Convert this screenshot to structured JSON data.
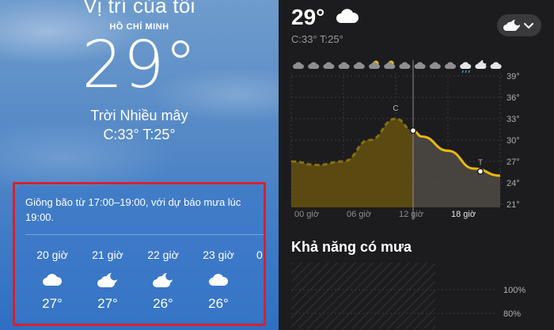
{
  "location": {
    "title": "Vị trí của tôi",
    "city": "HỒ CHÍ MINH",
    "temperature": "29°",
    "condition": "Trời Nhiều mây",
    "high_low": "C:33°  T:25°"
  },
  "forecast_card": {
    "text": "Giông bão từ 17:00–19:00, với dự báo mưa lúc 19:00.",
    "hours": [
      {
        "label": "20 giờ",
        "icon": "cloud-icon",
        "temp": "27°"
      },
      {
        "label": "21 giờ",
        "icon": "moon-cloud-icon",
        "temp": "27°"
      },
      {
        "label": "22 giờ",
        "icon": "moon-cloud-icon",
        "temp": "26°"
      },
      {
        "label": "23 giờ",
        "icon": "cloud-icon",
        "temp": "26°"
      }
    ],
    "next_hour_partial": "0"
  },
  "detail": {
    "temperature": "29°",
    "high_low": "C:33° T:25°",
    "rain_section_title": "Khả năng có mưa"
  },
  "chart_data": {
    "type": "area",
    "x": [
      "00 giờ",
      "03 giờ",
      "06 giờ",
      "09 giờ",
      "12 giờ",
      "15 giờ",
      "18 giờ",
      "21 giờ",
      "24 giờ"
    ],
    "xticks": [
      "00 giờ",
      "06 giờ",
      "12 giờ",
      "18 giờ"
    ],
    "values": [
      27,
      26.5,
      27,
      30,
      33,
      30.5,
      28.5,
      26,
      25
    ],
    "ylim": [
      21,
      39
    ],
    "yticks": [
      "39°",
      "36°",
      "33°",
      "30°",
      "27°",
      "24°",
      "21°"
    ],
    "markers": {
      "high": "C",
      "low": "T"
    },
    "now_hour": 14,
    "grid": true
  },
  "rain_chart": {
    "yticks": [
      "100%",
      "80%"
    ]
  },
  "colors": {
    "accent_yellow": "#e9b90b",
    "chart_fill": "#5a4a12",
    "alert_border": "#d2232f"
  }
}
